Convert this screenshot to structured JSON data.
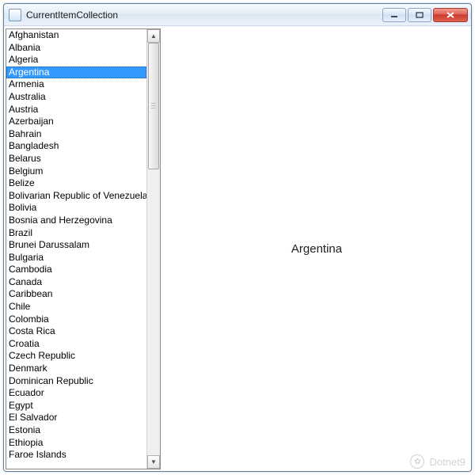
{
  "window": {
    "title": "CurrentItemCollection"
  },
  "list": {
    "selected_index": 3,
    "items": [
      "Afghanistan",
      "Albania",
      "Algeria",
      "Argentina",
      "Armenia",
      "Australia",
      "Austria",
      "Azerbaijan",
      "Bahrain",
      "Bangladesh",
      "Belarus",
      "Belgium",
      "Belize",
      "Bolivarian Republic of Venezuela",
      "Bolivia",
      "Bosnia and Herzegovina",
      "Brazil",
      "Brunei Darussalam",
      "Bulgaria",
      "Cambodia",
      "Canada",
      "Caribbean",
      "Chile",
      "Colombia",
      "Costa Rica",
      "Croatia",
      "Czech Republic",
      "Denmark",
      "Dominican Republic",
      "Ecuador",
      "Egypt",
      "El Salvador",
      "Estonia",
      "Ethiopia",
      "Faroe Islands"
    ]
  },
  "detail": {
    "current": "Argentina"
  },
  "watermark": {
    "text": "Dotnet9"
  }
}
